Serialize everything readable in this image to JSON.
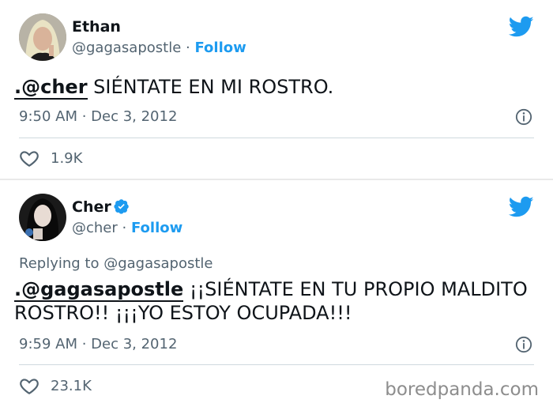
{
  "tweets": [
    {
      "name": "Ethan",
      "handle": "@gagasapostle",
      "separator": "·",
      "follow": "Follow",
      "mention": ".@cher",
      "text": " SIÉNTATE EN MI ROSTRO.",
      "timestamp": "9:50 AM · Dec 3, 2012",
      "likes": "1.9K"
    },
    {
      "name": "Cher",
      "handle": "@cher",
      "separator": "·",
      "follow": "Follow",
      "replying_to": "Replying to @gagasapostle",
      "mention": ".@gagasapostle",
      "text": " ¡¡SIÉNTATE EN TU PROPIO MALDITO ROSTRO!! ¡¡¡YO ESTOY OCUPADA!!!",
      "timestamp": "9:59 AM · Dec 3, 2012",
      "likes": "23.1K"
    }
  ],
  "watermark": "boredpanda.com",
  "colors": {
    "link": "#1d9bf0",
    "muted": "#536471",
    "text": "#0f1419"
  }
}
